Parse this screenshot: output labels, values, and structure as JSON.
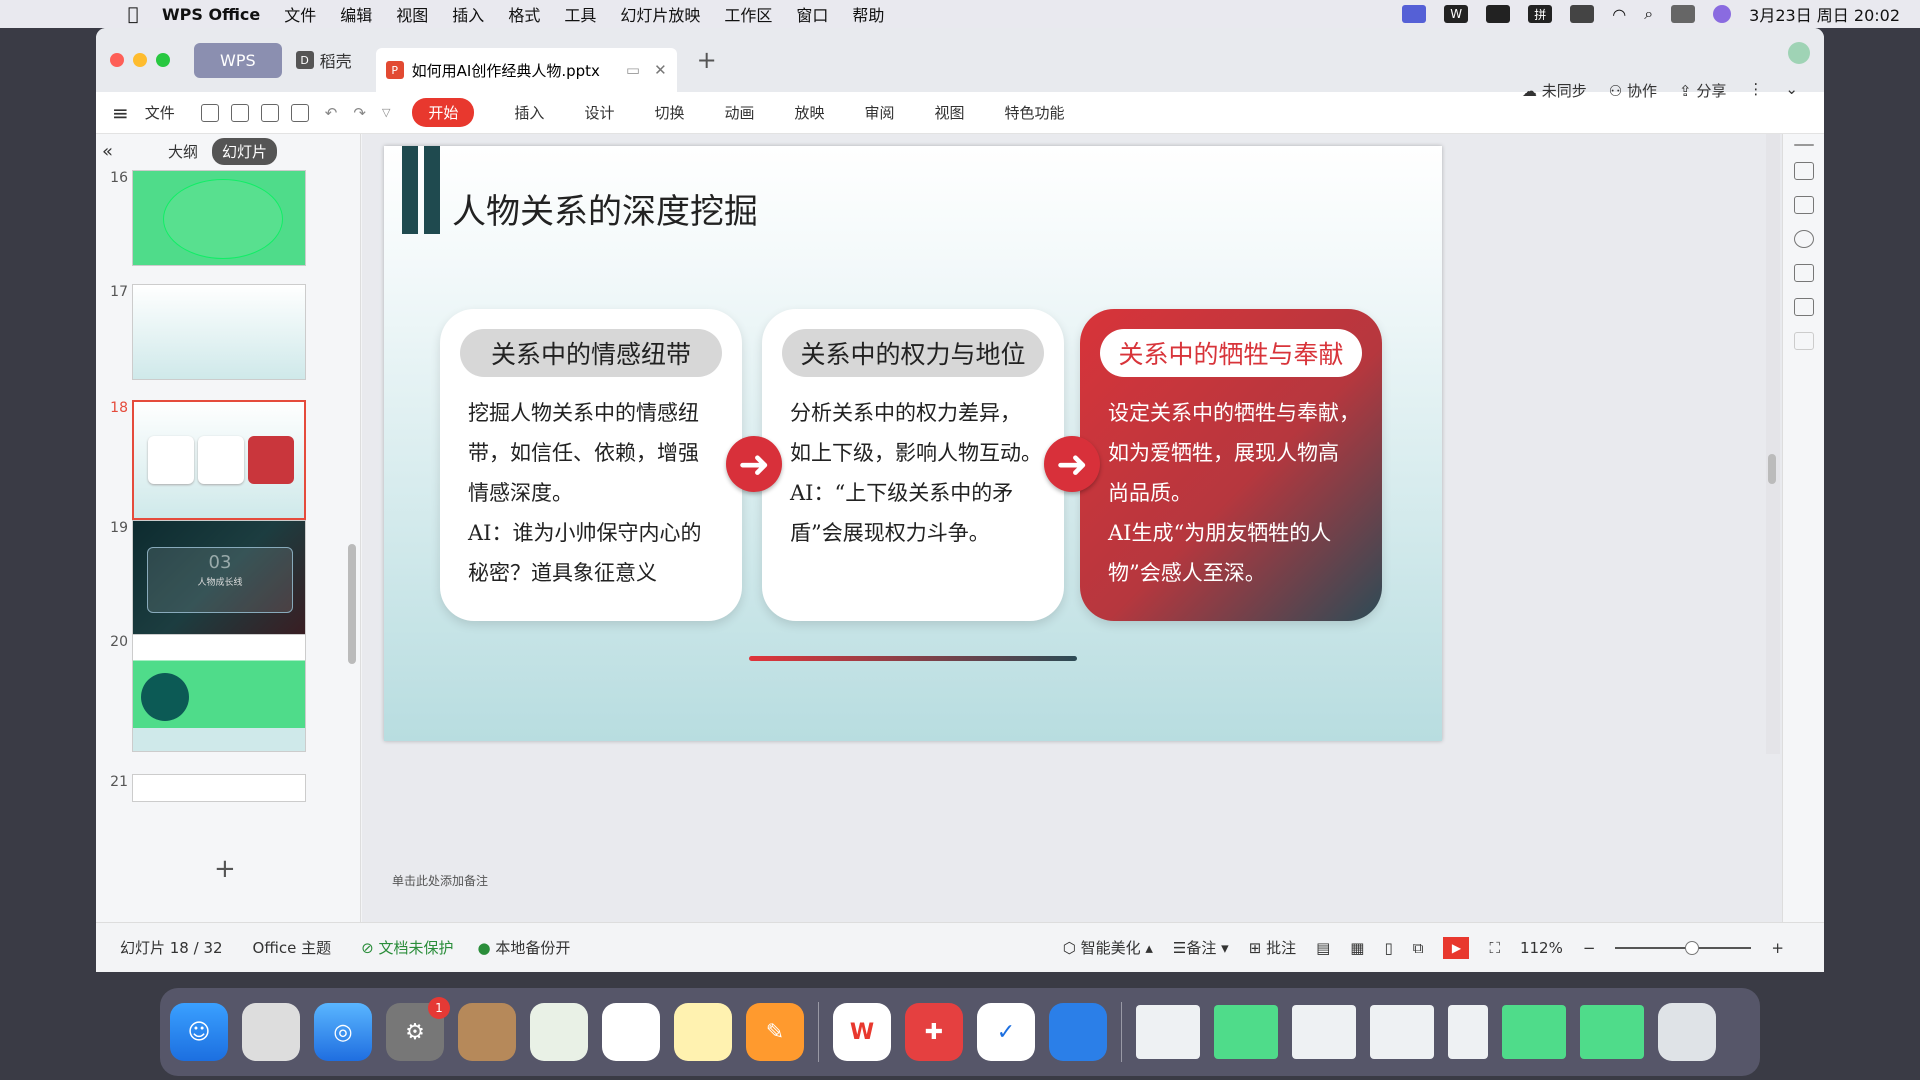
{
  "menubar": {
    "app": "WPS Office",
    "items": [
      "文件",
      "编辑",
      "视图",
      "插入",
      "格式",
      "工具",
      "幻灯片放映",
      "工作区",
      "窗口",
      "帮助"
    ],
    "datetime": "3月23日 周日 20:02"
  },
  "tabs": {
    "wps": "WPS",
    "daoke": "稻壳",
    "doc": "如何用AI创作经典人物.pptx"
  },
  "toolbar": {
    "file": "文件",
    "start": "开始",
    "menus": [
      "插入",
      "设计",
      "切换",
      "动画",
      "放映",
      "审阅",
      "视图",
      "特色功能"
    ],
    "sync": "未同步",
    "collab": "协作",
    "share": "分享"
  },
  "left_panel": {
    "outline": "大纲",
    "slides": "幻灯片",
    "thumb_numbers": [
      "16",
      "17",
      "18",
      "19",
      "20",
      "21"
    ],
    "thumb19_text": "03",
    "thumb19_sub": "人物成长线"
  },
  "slide": {
    "title": "人物关系的深度挖掘",
    "cards": [
      {
        "title": "关系中的情感纽带",
        "lines": [
          "挖掘人物关系中的情感纽",
          "带，如信任、依赖，增强",
          "情感深度。",
          "AI：谁为小帅保守内心的",
          "秘密？道具象征意义"
        ]
      },
      {
        "title": "关系中的权力与地位",
        "lines": [
          "分析关系中的权力差异，",
          "如上下级，影响人物互动。",
          "AI：“上下级关系中的矛",
          "盾”会展现权力斗争。"
        ]
      },
      {
        "title": "关系中的牺牲与奉献",
        "lines": [
          "设定关系中的牺牲与奉献，",
          "如为爱牺牲，展现人物高",
          "尚品质。",
          "AI生成“为朋友牺牲的人",
          "物”会感人至深。"
        ]
      }
    ]
  },
  "notes": "单击此处添加备注",
  "status": {
    "slide_pos": "幻灯片 18 / 32",
    "theme": "Office 主题",
    "protect": "文档未保护",
    "backup": "本地备份开",
    "beautify": "智能美化",
    "remarks": "备注",
    "comment": "批注",
    "zoom": "112%"
  },
  "dock": {
    "badge": "1"
  },
  "colors": {
    "accent": "#e8382e",
    "dark_teal": "#1f4a4f"
  }
}
